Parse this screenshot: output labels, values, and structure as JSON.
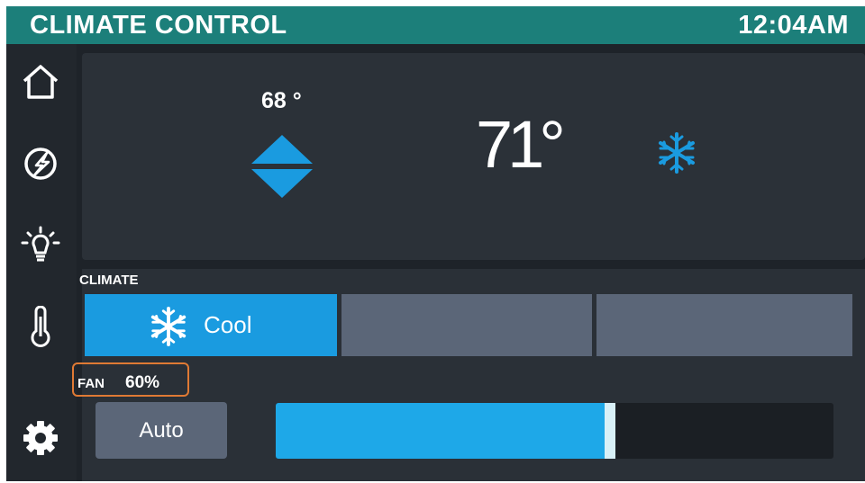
{
  "header": {
    "title": "CLIMATE CONTROL",
    "time": "12:04AM"
  },
  "sidebar": {
    "items": [
      {
        "id": "home",
        "icon": "home-icon"
      },
      {
        "id": "power",
        "icon": "lightning-icon"
      },
      {
        "id": "lighting",
        "icon": "lightbulb-icon"
      },
      {
        "id": "climate",
        "icon": "thermometer-icon"
      },
      {
        "id": "settings",
        "icon": "gear-icon"
      }
    ]
  },
  "thermostat": {
    "setpoint": "68 °",
    "current_temp": "71°",
    "mode_icon": "snowflake-icon"
  },
  "climate": {
    "label": "CLIMATE",
    "modes": [
      {
        "label": "Cool",
        "icon": "snowflake-icon",
        "active": true
      },
      {
        "label": "",
        "active": false
      },
      {
        "label": "",
        "active": false
      }
    ]
  },
  "fan": {
    "label": "FAN",
    "value": "60%",
    "level": 0.6,
    "auto_label": "Auto"
  },
  "colors": {
    "header": "#1c7f7a",
    "accent": "#1a9be0",
    "button_inactive": "#5b6678",
    "panel": "#2b3138",
    "highlight_box": "#e07a34"
  }
}
